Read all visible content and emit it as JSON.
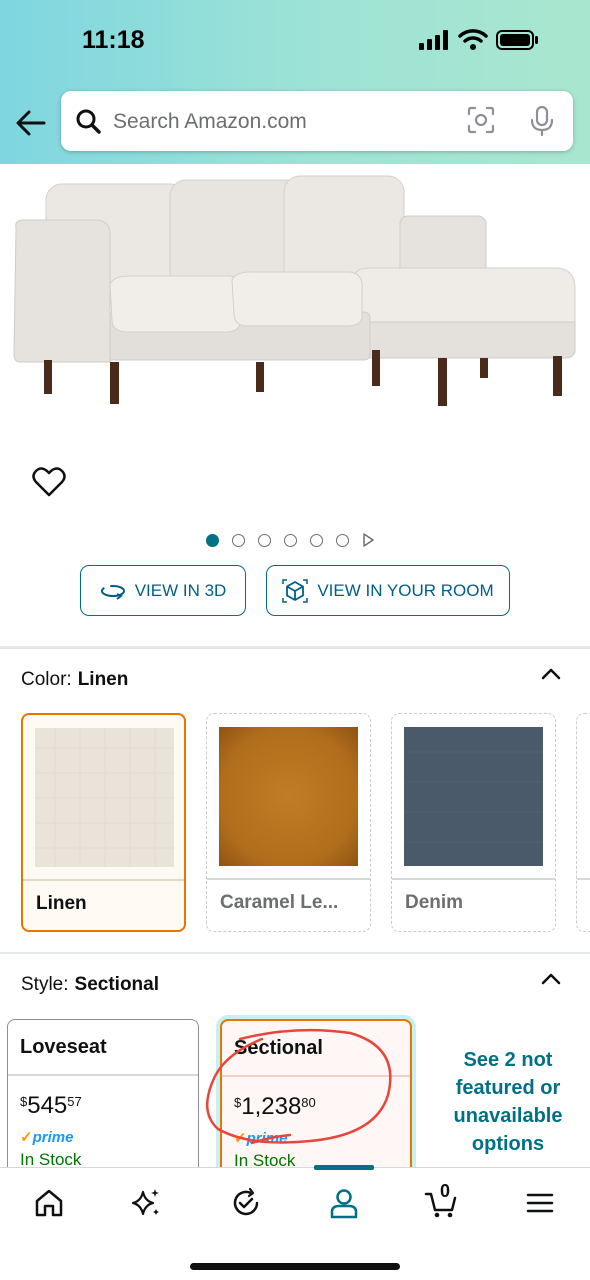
{
  "status_bar": {
    "time": "11:18"
  },
  "search": {
    "placeholder": "Search Amazon.com"
  },
  "gallery": {
    "image_count": 6,
    "active_index": 0,
    "view_3d_label": "VIEW IN 3D",
    "view_room_label": "VIEW IN YOUR ROOM"
  },
  "color_section": {
    "label": "Color:",
    "selected_value": "Linen",
    "swatches": [
      {
        "label": "Linen",
        "selected": true,
        "color": "#e9e3d9"
      },
      {
        "label": "Caramel Le...",
        "selected": false,
        "color": "#b8741f"
      },
      {
        "label": "Denim",
        "selected": false,
        "color": "#4a5a6b"
      }
    ]
  },
  "style_section": {
    "label": "Style:",
    "selected_value": "Sectional",
    "options": [
      {
        "title": "Loveseat",
        "price_symbol": "$",
        "price_whole": "545",
        "price_cents": "57",
        "prime": "prime",
        "stock": "In Stock"
      },
      {
        "title": "Sectional",
        "price_symbol": "$",
        "price_whole": "1,238",
        "price_cents": "80",
        "prime": "prime",
        "stock": "In Stock"
      }
    ],
    "see_more": "See 2 not featured or unavailable options"
  },
  "bottom_nav": {
    "cart_count": "0",
    "active_tab": "account"
  },
  "colors": {
    "accent_teal": "#007185",
    "selected_orange": "#e77600",
    "in_stock_green": "#007600",
    "prime_blue": "#1a98ff",
    "annotation_red": "#e8463a"
  }
}
